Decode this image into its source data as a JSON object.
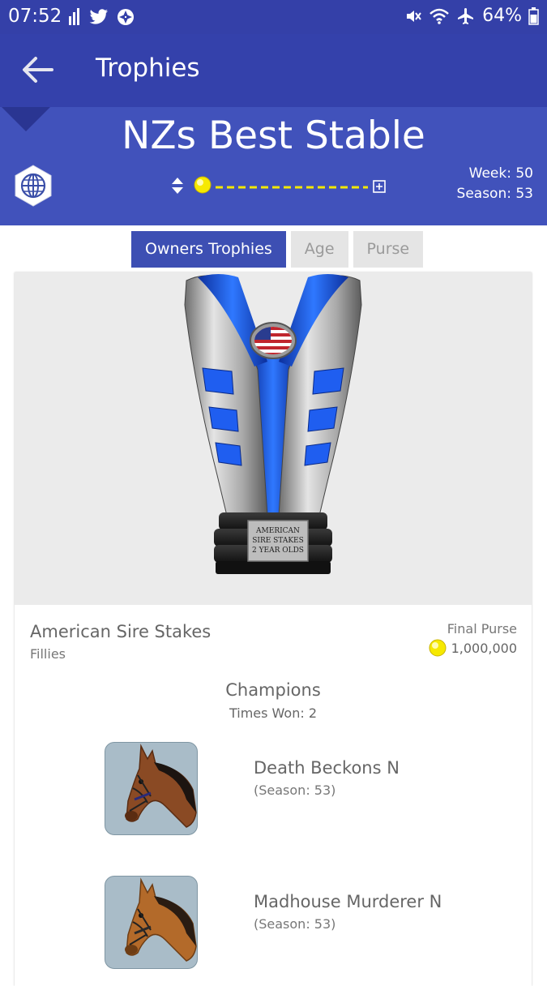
{
  "status_bar": {
    "time": "07:52",
    "battery_percent": "64%",
    "left_icons": [
      "signal-bars-icon",
      "twitter-icon",
      "aperture-icon"
    ],
    "right_icons": [
      "mute-icon",
      "wifi-icon",
      "airplane-icon",
      "battery-icon"
    ]
  },
  "app_bar": {
    "title": "Trophies"
  },
  "header": {
    "stable_name": "NZs Best Stable",
    "week": "Week: 50",
    "season": "Season: 53"
  },
  "tabs": [
    {
      "label": "Owners Trophies",
      "active": true
    },
    {
      "label": "Age",
      "active": false
    },
    {
      "label": "Purse",
      "active": false
    }
  ],
  "trophy": {
    "plaque_lines": [
      "AMERICAN",
      "SIRE STAKES",
      "2 YEAR OLDS"
    ]
  },
  "race": {
    "name": "American Sire Stakes",
    "subtitle": "Fillies",
    "purse_label": "Final Purse",
    "purse_value": "1,000,000"
  },
  "champions": {
    "title": "Champions",
    "times_won": "Times Won: 2",
    "items": [
      {
        "name": "Death Beckons N",
        "season": "(Season: 53)"
      },
      {
        "name": "Madhouse Murderer N",
        "season": "(Season: 53)"
      }
    ]
  },
  "colors": {
    "status_bar": "#3440a8",
    "app_bar": "#3441ab",
    "header_band": "#4152bb",
    "tab_active": "#3d4fb3",
    "coin_yellow": "#f6e900",
    "trophy_blue": "#1f5ef0"
  }
}
